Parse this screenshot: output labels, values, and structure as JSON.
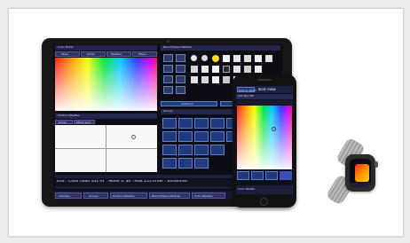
{
  "tablet": {
    "color_picker_window": {
      "title": "Color Picker",
      "tabs": [
        "Fader",
        "Picker",
        "Palettes",
        "Filters"
      ]
    },
    "beam_shape_window": {
      "title": "Beam/Shape Palettes",
      "footer": [
        "Available",
        "Live Available"
      ]
    },
    "position_window": {
      "title": "Position Palettes",
      "tabs": [
        "Picker",
        "Effect Grid"
      ]
    },
    "groups_window": {
      "title": "Groups"
    },
    "command_line": "Edit : Color Load 101 AT : Mode 3, all : Max 255 Enter : Enhanced",
    "bottom_tabs": [
      "Intensity",
      "Groups",
      "Position Palettes",
      "Beam/Shape Palettes",
      "Color Palettes"
    ],
    "clock": "09 : 18 AM"
  },
  "phone": {
    "header_button": "Back to Tablet",
    "title": "Tools View",
    "info_row": "101 Pan Tilt",
    "footer_label": "Color Palette"
  },
  "colors": {
    "accent": "#213a7c",
    "panel_border": "#5b7ed6",
    "background": "#ffffff"
  }
}
